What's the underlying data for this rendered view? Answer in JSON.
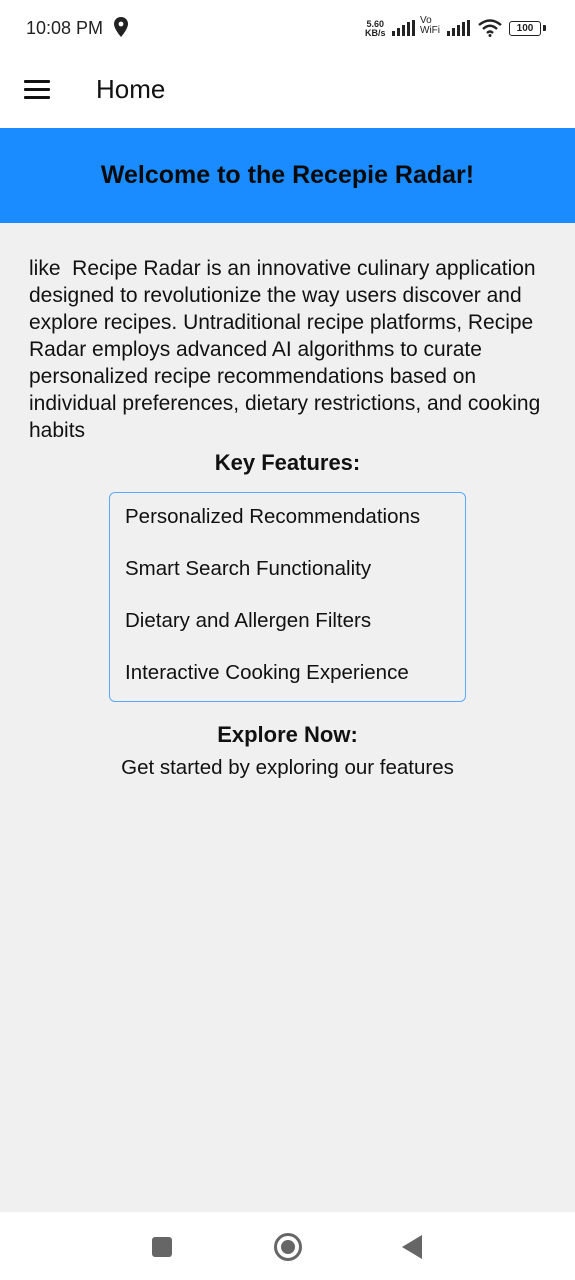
{
  "status_bar": {
    "time": "10:08 PM",
    "net_speed_value": "5.60",
    "net_speed_unit": "KB/s",
    "vowifi_top": "Vo",
    "vowifi_bottom": "WiFi",
    "battery": "100"
  },
  "app_bar": {
    "title": "Home"
  },
  "banner": {
    "title": "Welcome to the Recepie Radar!"
  },
  "intro": {
    "text": "like  Recipe Radar is an innovative culinary application designed to revolutionize the way users discover and explore recipes. Untraditional recipe platforms, Recipe Radar employs advanced AI algorithms to curate personalized recipe recommendations based on individual preferences, dietary restrictions, and cooking habits"
  },
  "key_features": {
    "title": "Key Features:",
    "items": [
      "Personalized Recommendations",
      "Smart Search Functionality",
      "Dietary and Allergen Filters",
      "Interactive Cooking Experience"
    ]
  },
  "explore": {
    "title": "Explore Now:",
    "text": "Get started by exploring our features"
  },
  "colors": {
    "banner": "#1a8cff",
    "feature_border": "#5aa8ff",
    "background": "#f0f0f0"
  }
}
